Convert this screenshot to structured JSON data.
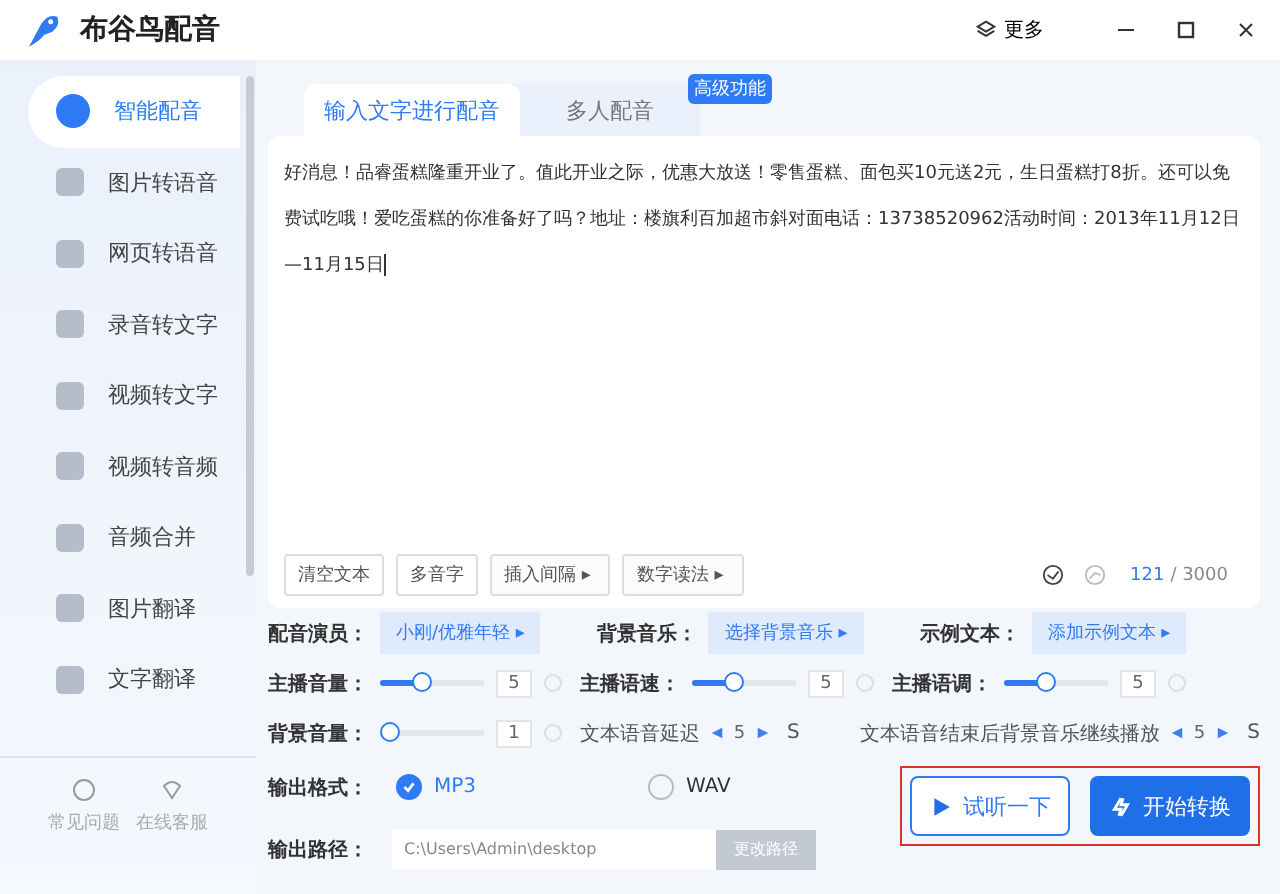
{
  "app": {
    "title": "布谷鸟配音",
    "more": "更多"
  },
  "sidebar": {
    "items": [
      {
        "label": "智能配音",
        "selected": true
      },
      {
        "label": "图片转语音",
        "selected": false
      },
      {
        "label": "网页转语音",
        "selected": false
      },
      {
        "label": "录音转文字",
        "selected": false
      },
      {
        "label": "视频转文字",
        "selected": false
      },
      {
        "label": "视频转音频",
        "selected": false
      },
      {
        "label": "音频合并",
        "selected": false
      },
      {
        "label": "图片翻译",
        "selected": false
      },
      {
        "label": "文字翻译",
        "selected": false
      }
    ],
    "footer": [
      "常见问题",
      "在线客服"
    ]
  },
  "badge": "高级功能",
  "tabs": [
    {
      "label": "输入文字进行配音",
      "selected": true
    },
    {
      "label": "多人配音",
      "selected": false
    }
  ],
  "editor": {
    "text": "好消息！品睿蛋糕隆重开业了。值此开业之际，优惠大放送！零售蛋糕、面包买10元送2元，生日蛋糕打8折。还可以免费试吃哦！爱吃蛋糕的你准备好了吗？地址：楼旗利百加超市斜对面电话：13738520962活动时间：2013年11月12日—11月15日",
    "tools": [
      {
        "label": "清空文本",
        "kind": "plain"
      },
      {
        "label": "多音字",
        "kind": "plain"
      },
      {
        "label": "插入间隔 ▸",
        "kind": "menu"
      },
      {
        "label": "数字读法 ▸",
        "kind": "menu"
      }
    ],
    "count": "121",
    "limit": "/ 3000"
  },
  "pickers": [
    {
      "label": "配音演员：",
      "value": "小刚/优雅年轻 ▸"
    },
    {
      "label": "背景音乐：",
      "value": "选择背景音乐 ▸"
    },
    {
      "label": "示例文本：",
      "value": "添加示例文本 ▸"
    }
  ],
  "sliders": [
    {
      "label": "主播音量：",
      "level": 0.4,
      "reading": "5"
    },
    {
      "label": "主播语速：",
      "level": 0.4,
      "reading": "5"
    },
    {
      "label": "主播语调：",
      "level": 0.4,
      "reading": "5"
    }
  ],
  "bg_volume": {
    "label": "背景音量：",
    "level": 0,
    "reading": "1"
  },
  "delays": [
    {
      "label": "文本语音延迟",
      "value": "5",
      "unit": "S"
    },
    {
      "label": "文本语音结束后背景音乐继续播放",
      "value": "5",
      "unit": "S"
    }
  ],
  "format": {
    "label": "输出格式：",
    "options": [
      {
        "label": "MP3",
        "selected": true
      },
      {
        "label": "WAV",
        "selected": false
      }
    ]
  },
  "path": {
    "label": "输出路径：",
    "value": "C:\\Users\\Admin\\desktop",
    "button": "更改路径"
  },
  "buttons": {
    "preview": "试听一下",
    "start": "开始转换"
  }
}
